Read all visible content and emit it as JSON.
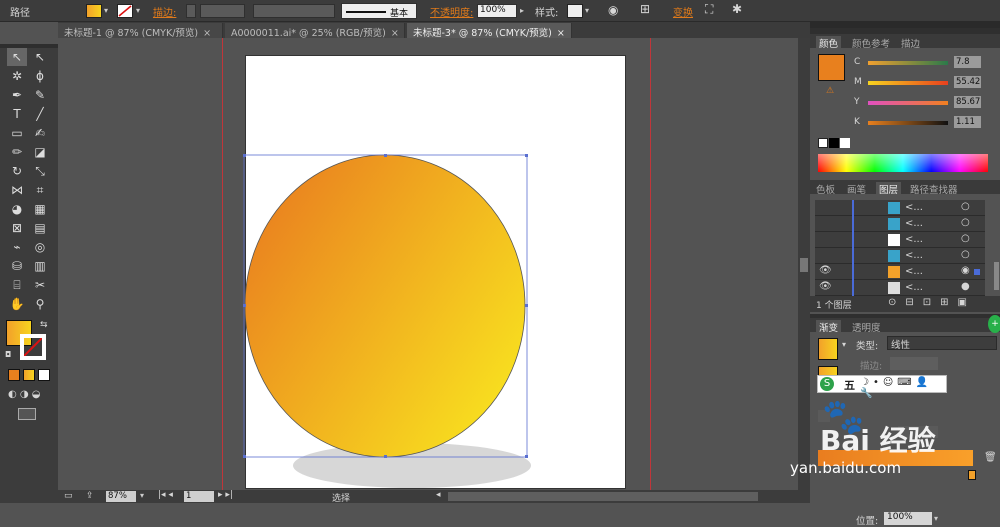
{
  "control_bar": {
    "object_type": "路径",
    "stroke_label": "描边:",
    "stroke_style": "基本",
    "opacity_label": "不透明度:",
    "opacity_value": "100%",
    "style_label": "样式:",
    "transform_label": "变换"
  },
  "doc_tabs": [
    {
      "label": "未标题-1 @ 87% (CMYK/预览)",
      "active": false
    },
    {
      "label": "A0000011.ai* @ 25% (RGB/预览)",
      "active": false
    },
    {
      "label": "未标题-3* @ 87% (CMYK/预览)",
      "active": true
    }
  ],
  "status_bar": {
    "zoom": "87%",
    "page": "1",
    "mode": "选择"
  },
  "color_panel": {
    "tabs": [
      "颜色",
      "颜色参考",
      "描边"
    ],
    "channels": [
      {
        "name": "C",
        "value": "7.8"
      },
      {
        "name": "M",
        "value": "55.42"
      },
      {
        "name": "Y",
        "value": "85.67"
      },
      {
        "name": "K",
        "value": "1.11"
      }
    ],
    "fill_color": "#e8801e"
  },
  "layers_panel": {
    "tabs": [
      "色板",
      "画笔",
      "图层",
      "路径查找器"
    ],
    "item_text": "<...",
    "layer_count": "1 个图层"
  },
  "gradient_panel": {
    "tabs": [
      "渐变",
      "透明度"
    ],
    "type_label": "类型:",
    "type_value": "线性",
    "stroke_label": "描边:",
    "position_label": "位置:",
    "position_value": "100%",
    "gradient_start": "#e97d1f",
    "gradient_end": "#f9e61f"
  },
  "ime_toolbar": {
    "label": "五"
  },
  "watermark": {
    "text": "Bai 经验",
    "url": "yan.baidu.com"
  }
}
